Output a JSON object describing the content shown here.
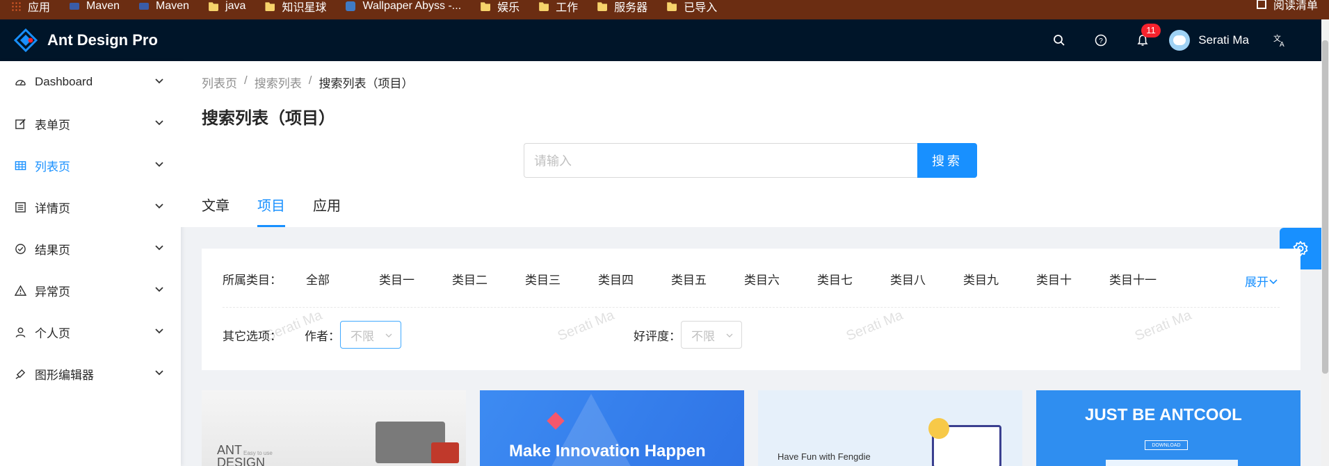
{
  "bookmarks": {
    "items": [
      {
        "label": "应用",
        "icon": "apps-icon"
      },
      {
        "label": "Maven",
        "icon": "maven-icon"
      },
      {
        "label": "Maven",
        "icon": "maven-icon"
      },
      {
        "label": "java",
        "icon": "folder-icon"
      },
      {
        "label": "知识星球",
        "icon": "folder-icon"
      },
      {
        "label": "Wallpaper Abyss -...",
        "icon": "wallpaper-icon"
      },
      {
        "label": "娱乐",
        "icon": "folder-icon"
      },
      {
        "label": "工作",
        "icon": "folder-icon"
      },
      {
        "label": "服务器",
        "icon": "folder-icon"
      },
      {
        "label": "已导入",
        "icon": "folder-icon"
      }
    ],
    "reading_list": "阅读清单"
  },
  "header": {
    "title": "Ant Design Pro",
    "notification_count": "11",
    "user_name": "Serati Ma",
    "colors": {
      "bg": "#001529",
      "badge": "#f5222d"
    }
  },
  "sidebar": {
    "items": [
      {
        "label": "Dashboard",
        "icon": "dashboard-icon"
      },
      {
        "label": "表单页",
        "icon": "form-icon"
      },
      {
        "label": "列表页",
        "icon": "table-icon",
        "active": true
      },
      {
        "label": "详情页",
        "icon": "profile-icon"
      },
      {
        "label": "结果页",
        "icon": "check-circle-icon"
      },
      {
        "label": "异常页",
        "icon": "warning-icon"
      },
      {
        "label": "个人页",
        "icon": "user-icon"
      },
      {
        "label": "图形编辑器",
        "icon": "highlight-icon"
      }
    ]
  },
  "page": {
    "breadcrumb": [
      "列表页",
      "搜索列表",
      "搜索列表（项目）"
    ],
    "title": "搜索列表（项目）",
    "search": {
      "placeholder": "请输入",
      "button": "搜索"
    },
    "tabs": [
      "文章",
      "项目",
      "应用"
    ],
    "active_tab": "项目"
  },
  "filter": {
    "category_label": "所属类目：",
    "categories": [
      "全部",
      "类目一",
      "类目二",
      "类目三",
      "类目四",
      "类目五",
      "类目六",
      "类目七",
      "类目八",
      "类目九",
      "类目十",
      "类目十一"
    ],
    "expand": "展开",
    "other_label": "其它选项：",
    "author_label": "作者：",
    "author_value": "不限",
    "rating_label": "好评度：",
    "rating_value": "不限",
    "watermark": "Serati Ma"
  },
  "cards": {
    "c1": {
      "line1": "ANT",
      "line2": "DESIGN",
      "small": "Easy to use"
    },
    "c2": {
      "text": "Make Innovation Happen"
    },
    "c3": {
      "text": "Have Fun with Fengdie"
    },
    "c4": {
      "text": "JUST BE ANTCOOL",
      "button": "DOWNLOAD"
    }
  },
  "accent": "#1890ff"
}
